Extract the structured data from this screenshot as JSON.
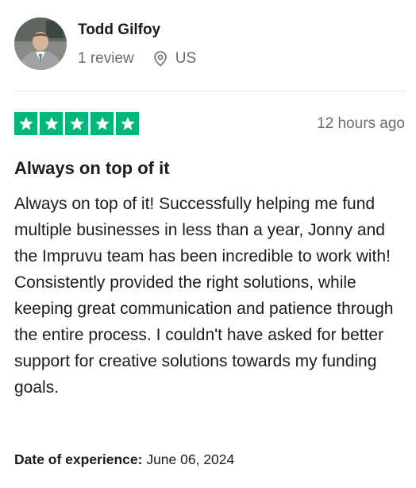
{
  "reviewer": {
    "name": "Todd Gilfoy",
    "review_count": "1 review",
    "country": "US"
  },
  "review": {
    "rating": 5,
    "max_rating": 5,
    "star_color": "#00b67a",
    "posted": "12 hours ago",
    "title": "Always on top of it",
    "body": "Always on top of it! Successfully helping me fund multiple businesses in less than a year, Jonny and the Impruvu team has been incredible to work with! Consistently provided the right solutions, while keeping great communication and patience through the entire process. I couldn't have asked for better support for creative solutions towards my funding goals.",
    "experience_label": "Date of experience:",
    "experience_date": "June 06, 2024"
  },
  "icons": {
    "location": "location-pin-icon",
    "star": "star-icon"
  }
}
